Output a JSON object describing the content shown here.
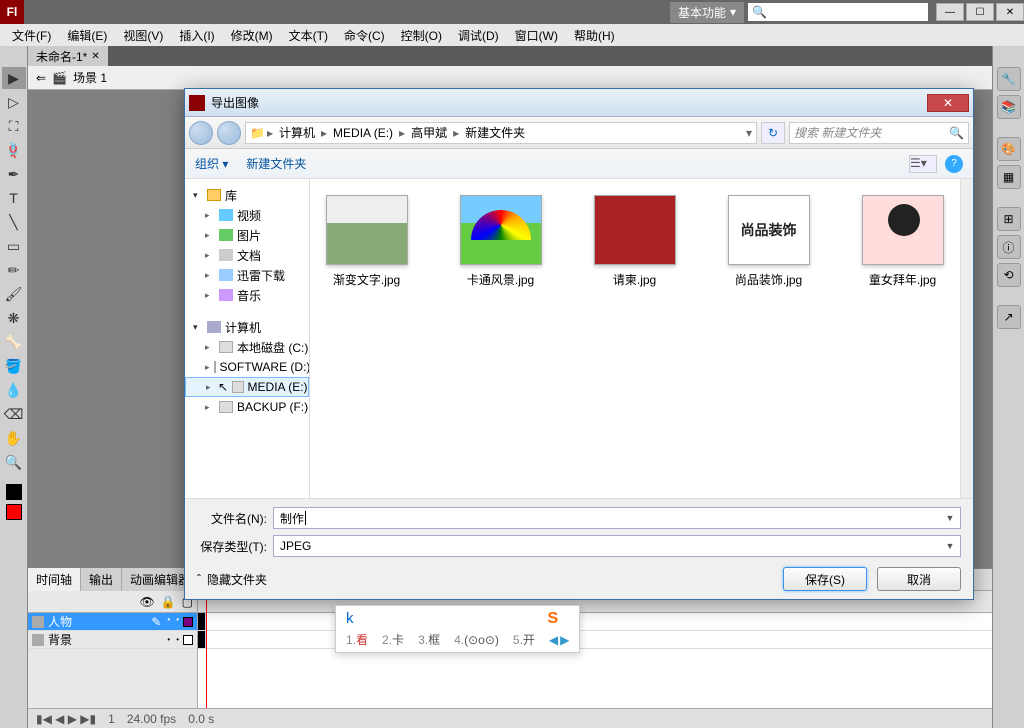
{
  "app": {
    "logo": "Fl",
    "workspace": "基本功能"
  },
  "window_buttons": {
    "min": "—",
    "max": "☐",
    "close": "✕"
  },
  "menu": [
    "文件(F)",
    "编辑(E)",
    "视图(V)",
    "插入(I)",
    "修改(M)",
    "文本(T)",
    "命令(C)",
    "控制(O)",
    "调试(D)",
    "窗口(W)",
    "帮助(H)"
  ],
  "doc": {
    "tab": "未命名-1*",
    "scene": "场景 1"
  },
  "panel_tabs": [
    "时间轴",
    "输出",
    "动画编辑器"
  ],
  "layers": [
    {
      "name": "人物",
      "selected": true,
      "color": "#800080"
    },
    {
      "name": "背景",
      "selected": false,
      "color": "#800080"
    }
  ],
  "timeline_status": {
    "frame": "1",
    "fps": "24.00 fps",
    "time": "0.0 s"
  },
  "dialog": {
    "title": "导出图像",
    "breadcrumb": [
      "计算机",
      "MEDIA (E:)",
      "高甲斌",
      "新建文件夹"
    ],
    "search_placeholder": "搜索 新建文件夹",
    "toolbar": {
      "organize": "组织",
      "newfolder": "新建文件夹"
    },
    "tree": {
      "lib": "库",
      "video": "视频",
      "pictures": "图片",
      "documents": "文档",
      "downloads": "迅雷下载",
      "music": "音乐",
      "computer": "计算机",
      "c": "本地磁盘 (C:)",
      "d": "SOFTWARE (D:)",
      "e": "MEDIA (E:)",
      "f": "BACKUP (F:)"
    },
    "thumbs": [
      {
        "label": "渐变文字.jpg"
      },
      {
        "label": "卡通风景.jpg"
      },
      {
        "label": "请柬.jpg"
      },
      {
        "label": "尚品装饰.jpg",
        "caption": "尚品装饰"
      },
      {
        "label": "童女拜年.jpg"
      }
    ],
    "filename_label": "文件名(N):",
    "filename_value": "制作",
    "filetype_label": "保存类型(T):",
    "filetype_value": "JPEG",
    "hide_folders": "隐藏文件夹",
    "save": "保存(S)",
    "cancel": "取消"
  },
  "ime": {
    "input": "k",
    "candidates": [
      {
        "n": "1.",
        "t": "看",
        "hl": true
      },
      {
        "n": "2.",
        "t": "卡"
      },
      {
        "n": "3.",
        "t": "框"
      },
      {
        "n": "4.",
        "t": "(⊙o⊙)"
      },
      {
        "n": "5.",
        "t": "开"
      }
    ]
  }
}
